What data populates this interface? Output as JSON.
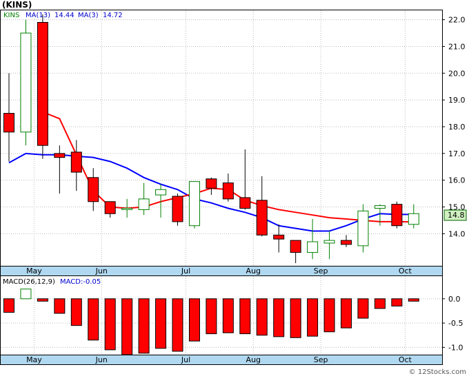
{
  "ticker": "(KINS)",
  "watermark": "© 12Stocks.com",
  "colors": {
    "up_fill": "#ffffff",
    "up_stroke": "#008000",
    "down_fill": "#ff0000",
    "down_stroke": "#000000",
    "ma13": "#ff0000",
    "ma3": "#0000ff",
    "macd_bar": "#ff0000",
    "grid": "#bbbbbb",
    "axis_band": "#b0d8f0",
    "last_price_box": "#d0f0c0"
  },
  "legend": {
    "symbol": "KINS",
    "ma13_label": "MA(13)",
    "ma13_value": "14.44",
    "ma3_label": "MA(3)",
    "ma3_value": "14.72"
  },
  "last_price": "14.8",
  "chart_data": [
    {
      "type": "candlestick",
      "y_axis_side": "right",
      "ylim": [
        12.8,
        22.35
      ],
      "y_ticks": [
        "14.0",
        "15.0",
        "16.0",
        "17.0",
        "18.0",
        "19.0",
        "20.0",
        "21.0",
        "22.0"
      ],
      "x_ticks": [
        {
          "label": "May",
          "index": 1
        },
        {
          "label": "Jun",
          "index": 5
        },
        {
          "label": "Jul",
          "index": 10
        },
        {
          "label": "Aug",
          "index": 14
        },
        {
          "label": "Sep",
          "index": 18
        },
        {
          "label": "Oct",
          "index": 23
        }
      ],
      "candles": [
        {
          "open": 18.5,
          "high": 20.0,
          "low": 16.7,
          "close": 17.8
        },
        {
          "open": 17.8,
          "high": 22.0,
          "low": 17.3,
          "close": 21.5
        },
        {
          "open": 21.9,
          "high": 22.2,
          "low": 16.8,
          "close": 17.3
        },
        {
          "open": 17.0,
          "high": 17.3,
          "low": 15.5,
          "close": 16.85
        },
        {
          "open": 17.05,
          "high": 17.5,
          "low": 15.6,
          "close": 16.3
        },
        {
          "open": 16.1,
          "high": 16.45,
          "low": 14.85,
          "close": 15.2
        },
        {
          "open": 15.2,
          "high": 15.2,
          "low": 14.6,
          "close": 14.75
        },
        {
          "open": 14.9,
          "high": 15.3,
          "low": 14.6,
          "close": 14.95
        },
        {
          "open": 14.9,
          "high": 15.9,
          "low": 14.7,
          "close": 15.3
        },
        {
          "open": 15.45,
          "high": 15.85,
          "low": 14.6,
          "close": 15.65
        },
        {
          "open": 15.4,
          "high": 15.5,
          "low": 14.3,
          "close": 14.45
        },
        {
          "open": 14.3,
          "high": 15.95,
          "low": 14.2,
          "close": 15.95
        },
        {
          "open": 16.05,
          "high": 16.1,
          "low": 15.45,
          "close": 15.7
        },
        {
          "open": 15.9,
          "high": 16.25,
          "low": 15.2,
          "close": 15.3
        },
        {
          "open": 15.35,
          "high": 17.15,
          "low": 14.9,
          "close": 14.95
        },
        {
          "open": 15.25,
          "high": 16.15,
          "low": 13.9,
          "close": 13.95
        },
        {
          "open": 13.95,
          "high": 14.35,
          "low": 13.3,
          "close": 13.8
        },
        {
          "open": 13.75,
          "high": 13.75,
          "low": 12.9,
          "close": 13.3
        },
        {
          "open": 13.3,
          "high": 14.55,
          "low": 13.05,
          "close": 13.7
        },
        {
          "open": 13.65,
          "high": 14.1,
          "low": 13.05,
          "close": 13.75
        },
        {
          "open": 13.75,
          "high": 13.95,
          "low": 13.5,
          "close": 13.6
        },
        {
          "open": 13.55,
          "high": 15.1,
          "low": 13.3,
          "close": 14.85
        },
        {
          "open": 14.95,
          "high": 15.1,
          "low": 14.3,
          "close": 15.05
        },
        {
          "open": 15.1,
          "high": 15.2,
          "low": 14.2,
          "close": 14.3
        },
        {
          "open": 14.35,
          "high": 15.1,
          "low": 14.2,
          "close": 14.75
        }
      ],
      "ma13": [
        null,
        null,
        18.55,
        18.3,
        16.95,
        15.6,
        15.0,
        14.95,
        15.0,
        15.2,
        15.35,
        15.5,
        15.7,
        15.65,
        15.25,
        15.05,
        14.9,
        14.8,
        14.7,
        14.6,
        14.55,
        14.5,
        14.45,
        14.45,
        14.44
      ],
      "ma3": [
        16.65,
        17.0,
        16.95,
        16.95,
        16.9,
        16.85,
        16.7,
        16.45,
        16.1,
        15.85,
        15.65,
        15.3,
        15.15,
        14.95,
        14.8,
        14.6,
        14.3,
        14.2,
        14.1,
        14.1,
        14.3,
        14.55,
        14.75,
        14.72,
        14.72
      ]
    },
    {
      "type": "bar",
      "label": "MACD(26,12,9)",
      "value_label": "MACD:-0.05",
      "y_axis_side": "right",
      "ylim": [
        -1.15,
        0.38
      ],
      "y_ticks": [
        "0.0",
        "-0.5",
        "-1.0"
      ],
      "values": [
        -0.28,
        0.2,
        -0.05,
        -0.3,
        -0.55,
        -0.85,
        -1.05,
        -1.15,
        -1.12,
        -1.02,
        -1.08,
        -0.87,
        -0.72,
        -0.7,
        -0.72,
        -0.75,
        -0.78,
        -0.8,
        -0.77,
        -0.68,
        -0.6,
        -0.4,
        -0.2,
        -0.15,
        -0.05
      ]
    }
  ]
}
